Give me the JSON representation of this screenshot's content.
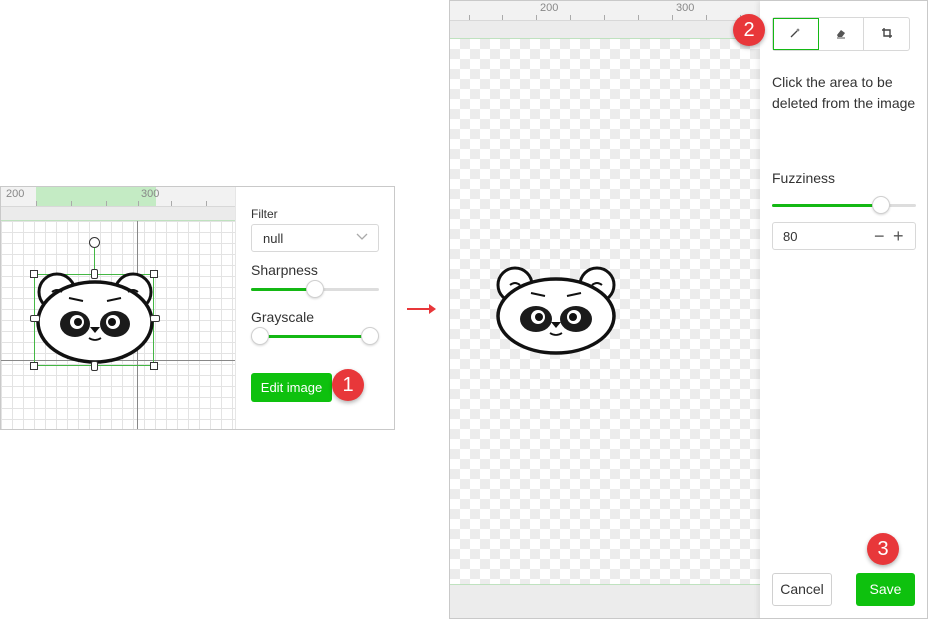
{
  "left_editor": {
    "ruler": {
      "mark_200": "200",
      "mark_300": "300"
    },
    "properties": {
      "filter_label": "Filter",
      "filter_value": "null",
      "sharpness_label": "Sharpness",
      "sharpness_fraction": 0.5,
      "grayscale_label": "Grayscale",
      "grayscale_range": [
        0,
        1
      ],
      "edit_button": "Edit image"
    }
  },
  "steps": {
    "step1": "1",
    "step2": "2",
    "step3": "3"
  },
  "right_editor": {
    "ruler": {
      "mark_200": "200",
      "mark_300": "300"
    },
    "tools": [
      "magic-wand-icon",
      "eraser-icon",
      "crop-icon"
    ],
    "active_tool": "magic-wand-icon",
    "description": "Click the area to be deleted from the image",
    "fuzziness_label": "Fuzziness",
    "fuzziness_fraction": 0.82,
    "fuzziness_value": "80",
    "cancel_button": "Cancel",
    "save_button": "Save"
  },
  "colors": {
    "accent": "#0ec10e",
    "badge": "#e8373a"
  }
}
